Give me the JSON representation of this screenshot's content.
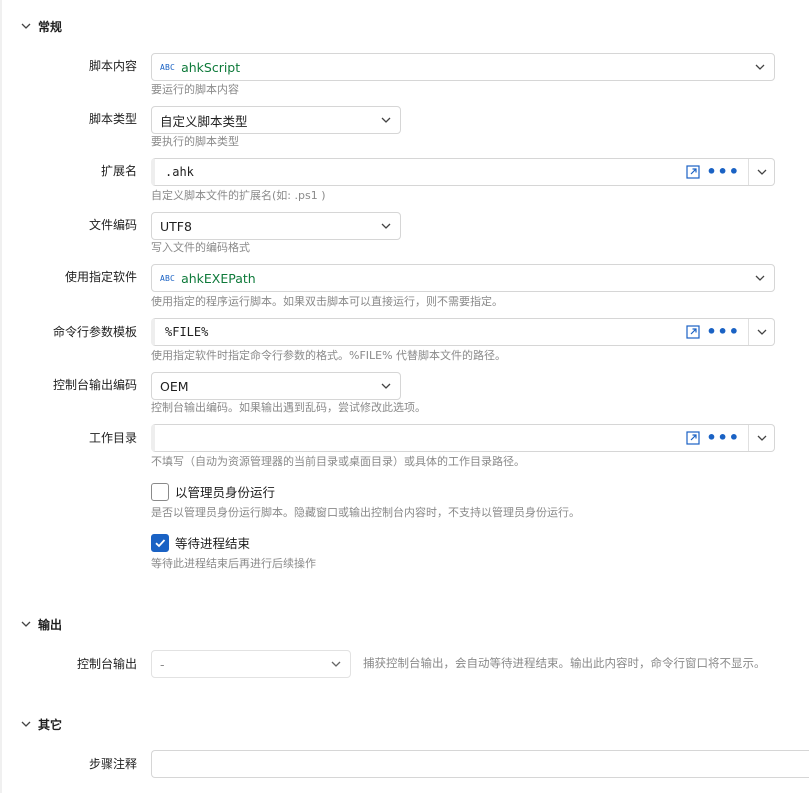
{
  "sections": {
    "general": "常规",
    "output": "输出",
    "other": "其它"
  },
  "fields": {
    "script_content": {
      "label": "脚本内容",
      "value": "ahkScript",
      "badge": "ABC",
      "hint": "要运行的脚本内容"
    },
    "script_type": {
      "label": "脚本类型",
      "value": "自定义脚本类型",
      "hint": "要执行的脚本类型"
    },
    "extension": {
      "label": "扩展名",
      "value": ".ahk",
      "hint": "自定义脚本文件的扩展名(如: .ps1 )"
    },
    "file_encoding": {
      "label": "文件编码",
      "value": "UTF8",
      "hint": "写入文件的编码格式"
    },
    "use_software": {
      "label": "使用指定软件",
      "value": "ahkEXEPath",
      "badge": "ABC",
      "hint": "使用指定的程序运行脚本。如果双击脚本可以直接运行，则不需要指定。"
    },
    "cmd_template": {
      "label": "命令行参数模板",
      "value": "%FILE%",
      "hint": "使用指定软件时指定命令行参数的格式。%FILE% 代替脚本文件的路径。"
    },
    "console_encoding": {
      "label": "控制台输出编码",
      "value": "OEM",
      "hint": "控制台输出编码。如果输出遇到乱码，尝试修改此选项。"
    },
    "work_dir": {
      "label": "工作目录",
      "value": "",
      "hint": "不填写（自动为资源管理器的当前目录或桌面目录）或具体的工作目录路径。"
    },
    "run_as_admin": {
      "label": "以管理员身份运行",
      "checked": false,
      "hint": "是否以管理员身份运行脚本。隐藏窗口或输出控制台内容时，不支持以管理员身份运行。"
    },
    "wait_process": {
      "label": "等待进程结束",
      "checked": true,
      "hint": "等待此进程结束后再进行后续操作"
    },
    "console_output": {
      "label": "控制台输出",
      "value": "-",
      "hint": "捕获控制台输出，会自动等待进程结束。输出此内容时，命令行窗口将不显示。"
    },
    "step_note": {
      "label": "步骤注释",
      "value": ""
    }
  },
  "icons": {
    "chevron": "chevron-down-icon",
    "external": "open-external-icon",
    "more": "more-dots-icon",
    "dots": "•••",
    "check": "checkmark-icon"
  },
  "colors": {
    "accent": "#1a62c4",
    "variable_text": "#0e7a3a",
    "hint_text": "#8a8a8a"
  }
}
